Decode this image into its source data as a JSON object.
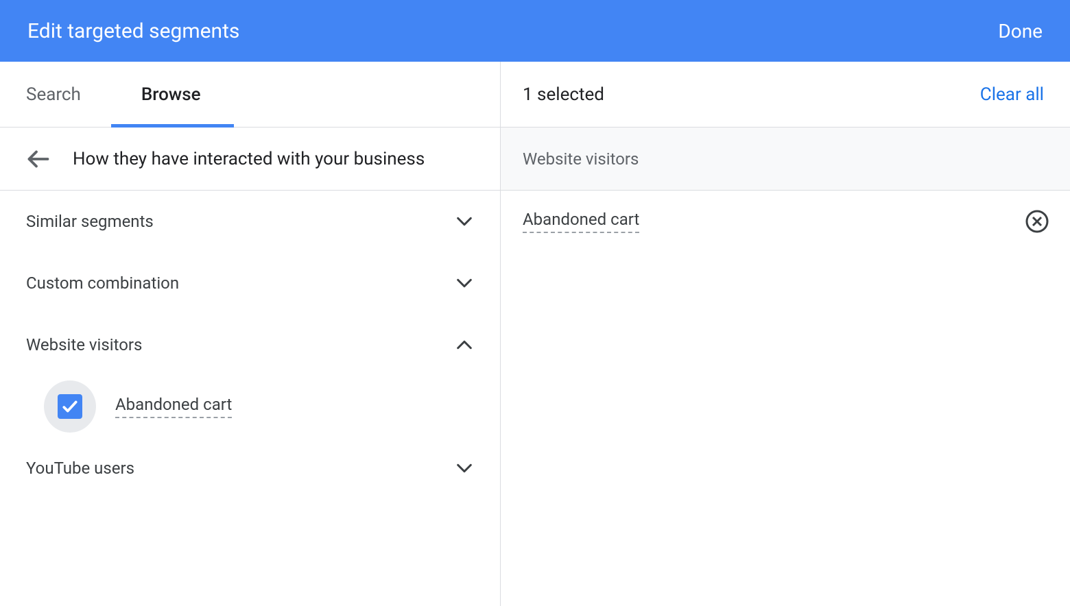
{
  "header": {
    "title": "Edit targeted segments",
    "done_label": "Done"
  },
  "tabs": {
    "search": "Search",
    "browse": "Browse"
  },
  "breadcrumb": {
    "label": "How they have interacted with your business"
  },
  "categories": [
    {
      "label": "Similar segments",
      "expanded": false
    },
    {
      "label": "Custom combination",
      "expanded": false
    },
    {
      "label": "Website visitors",
      "expanded": true,
      "items": [
        {
          "label": "Abandoned cart",
          "checked": true
        }
      ]
    },
    {
      "label": "YouTube users",
      "expanded": false
    }
  ],
  "selected": {
    "count_label": "1 selected",
    "clear_label": "Clear all",
    "groups": [
      {
        "title": "Website visitors",
        "items": [
          {
            "label": "Abandoned cart"
          }
        ]
      }
    ]
  }
}
